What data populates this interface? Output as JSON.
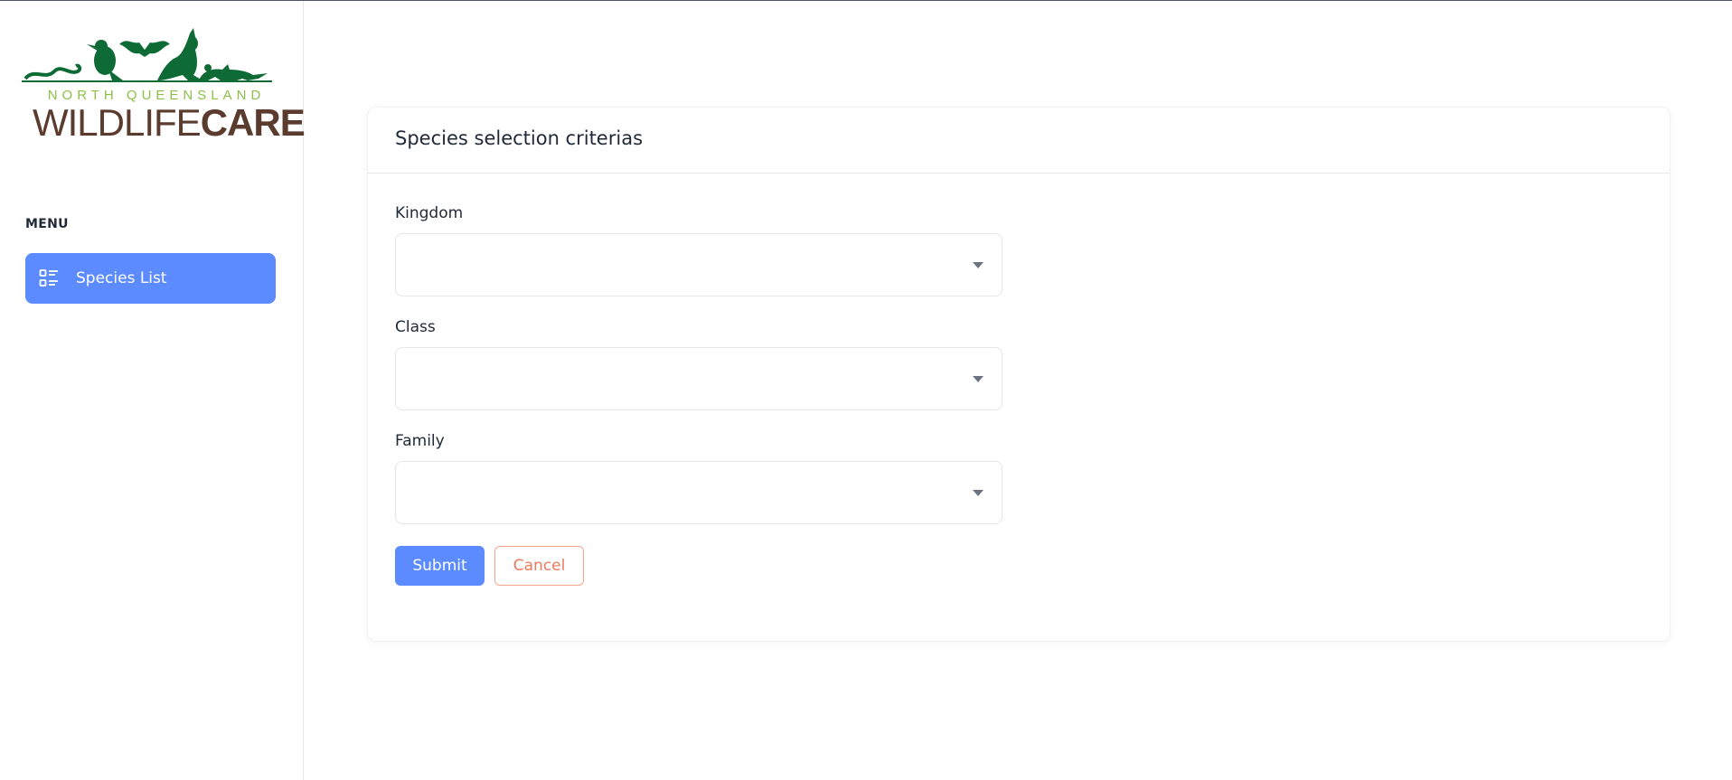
{
  "brand": {
    "logo_top_text": "NORTH QUEENSLAND",
    "logo_main_thin": "WILDLIFE",
    "logo_main_bold": "CARE",
    "colors": {
      "green": "#0f6b35",
      "lime": "#8cc04b",
      "brown": "#5a3b2e"
    }
  },
  "sidebar": {
    "menu_label": "MENU",
    "items": [
      {
        "label": "Species List",
        "icon": "list-icon",
        "active": true
      }
    ]
  },
  "form": {
    "title": "Species selection criterias",
    "fields": [
      {
        "label": "Kingdom",
        "value": ""
      },
      {
        "label": "Class",
        "value": ""
      },
      {
        "label": "Family",
        "value": ""
      }
    ],
    "submit_label": "Submit",
    "cancel_label": "Cancel"
  },
  "colors": {
    "accent": "#5b8bff",
    "cancel": "#f07a5a"
  }
}
